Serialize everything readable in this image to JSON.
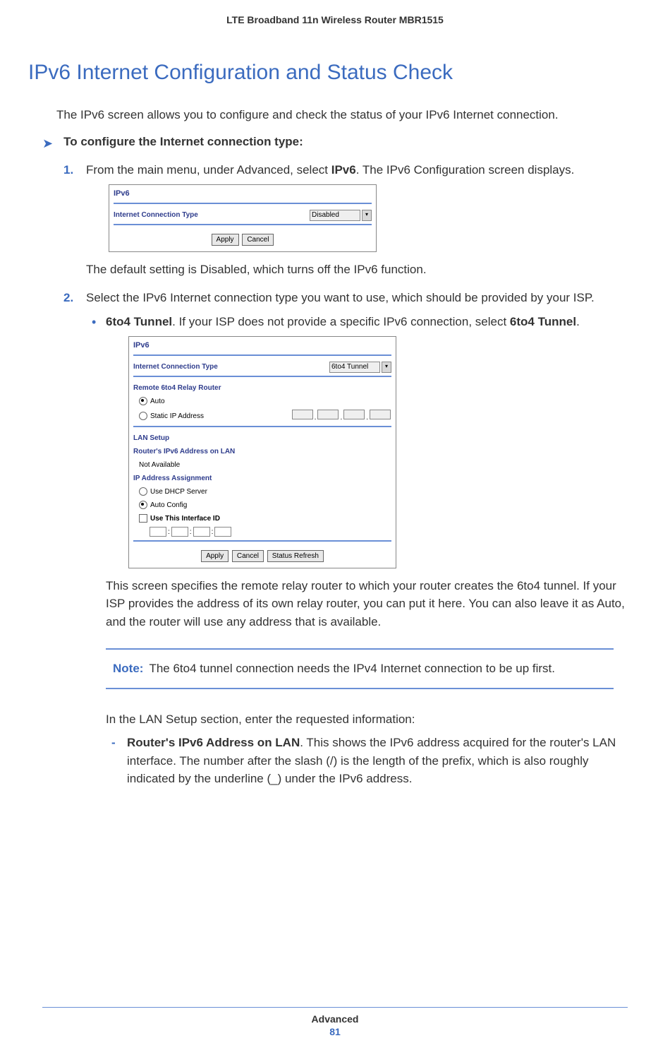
{
  "header": {
    "title": "LTE Broadband 11n Wireless Router MBR1515"
  },
  "main": {
    "title": "IPv6 Internet Configuration and Status Check",
    "intro": "The IPv6 screen allows you to configure and check the status of your IPv6 Internet connection.",
    "procedure_heading": "To configure the Internet connection type:",
    "step1": {
      "pre": "From the main menu, under Advanced, select ",
      "bold": "IPv6",
      "post": ". The IPv6 Configuration screen displays.",
      "after": "The default setting is Disabled, which turns off the IPv6 function."
    },
    "screenshot1": {
      "title": "IPv6",
      "row_label": "Internet Connection Type",
      "select_value": "Disabled",
      "apply": "Apply",
      "cancel": "Cancel"
    },
    "step2": {
      "text": "Select the IPv6 Internet connection type you want to use, which should be provided by your ISP.",
      "bullet1_bold": "6to4 Tunnel",
      "bullet1_mid": ". If your ISP does not provide a specific IPv6 connection, select ",
      "bullet1_bold2": "6to4 Tunnel",
      "bullet1_end": ".",
      "after_ss": "This screen specifies the remote relay router to which your router creates the 6to4 tunnel. If your ISP provides the address of its own relay router, you can put it here. You can also leave it as Auto, and the router will use any address that is available.",
      "lan_intro": "In the LAN Setup section, enter the requested information:",
      "dash1_bold": "Router's IPv6 Address on LAN",
      "dash1_text": ". This shows the IPv6 address acquired for the router's LAN interface. The number after the slash (/) is the length of the prefix, which is also roughly indicated by the underline (_) under the IPv6 address."
    },
    "screenshot2": {
      "title": "IPv6",
      "conn_label": "Internet Connection Type",
      "conn_value": "6to4 Tunnel",
      "relay_heading": "Remote 6to4 Relay Router",
      "auto": "Auto",
      "static": "Static IP Address",
      "lan_setup": "LAN Setup",
      "router_addr": "Router's IPv6 Address on LAN",
      "not_avail": "Not Available",
      "ip_assign": "IP Address Assignment",
      "dhcp": "Use DHCP Server",
      "autoconf": "Auto Config",
      "use_iface": "Use This Interface ID",
      "apply": "Apply",
      "cancel": "Cancel",
      "refresh": "Status Refresh"
    },
    "note": {
      "label": "Note:",
      "text": "The 6to4 tunnel connection needs the IPv4 Internet connection to be up first."
    }
  },
  "footer": {
    "section": "Advanced",
    "page": "81"
  }
}
